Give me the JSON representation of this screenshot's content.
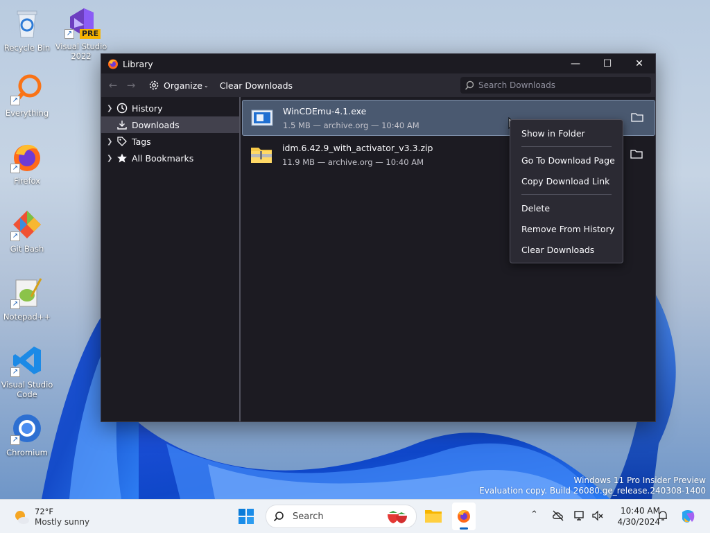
{
  "desktop_icons": [
    {
      "label": "Recycle Bin",
      "icon": "recycle-bin-icon"
    },
    {
      "label": "Visual Studio 2022 Preview",
      "badge": "PRE",
      "icon": "visual-studio-icon"
    },
    {
      "label": "Everything",
      "icon": "everything-search-icon"
    },
    {
      "label": "Firefox",
      "icon": "firefox-icon"
    },
    {
      "label": "Git Bash",
      "icon": "git-bash-icon"
    },
    {
      "label": "Notepad++",
      "icon": "notepad-plus-plus-icon"
    },
    {
      "label": "Visual Studio Code",
      "icon": "vscode-icon"
    },
    {
      "label": "Chromium",
      "icon": "chromium-icon"
    }
  ],
  "window": {
    "title": "Library",
    "controls": {
      "minimize": "—",
      "maximize": "☐",
      "close": "✕"
    }
  },
  "toolbar": {
    "organize_label": "Organize",
    "clear_downloads_label": "Clear Downloads",
    "search_placeholder": "Search Downloads"
  },
  "sidebar": {
    "items": [
      {
        "label": "History",
        "icon": "clock-icon",
        "expandable": true
      },
      {
        "label": "Downloads",
        "icon": "download-icon",
        "expandable": false,
        "selected": true
      },
      {
        "label": "Tags",
        "icon": "tag-icon",
        "expandable": true
      },
      {
        "label": "All Bookmarks",
        "icon": "star-icon",
        "expandable": true
      }
    ]
  },
  "downloads": [
    {
      "name": "WinCDEmu-4.1.exe",
      "meta": "1.5 MB — archive.org — 10:40 AM",
      "icon": "exe-installer-icon",
      "selected": true
    },
    {
      "name": "idm.6.42.9_with_activator_v3.3.zip",
      "meta": "11.9 MB — archive.org — 10:40 AM",
      "icon": "zip-folder-icon",
      "selected": false
    }
  ],
  "context_menu": {
    "show_in_folder": "Show in Folder",
    "go_to_download_page": "Go To Download Page",
    "copy_download_link": "Copy Download Link",
    "delete": "Delete",
    "remove_from_history": "Remove From History",
    "clear_downloads": "Clear Downloads"
  },
  "watermark": {
    "line1": "Windows 11 Pro Insider Preview",
    "line2": "Evaluation copy. Build 26080.ge_release.240308-1400"
  },
  "taskbar": {
    "weather_temp": "72°F",
    "weather_desc": "Mostly sunny",
    "search_placeholder": "Search",
    "clock_time": "10:40 AM",
    "clock_date": "4/30/2024"
  },
  "colors": {
    "window_bg": "#1c1b22",
    "toolbar_bg": "#2b2a33",
    "selection": "#4a5970",
    "taskbar_bg": "#eef2f7"
  }
}
